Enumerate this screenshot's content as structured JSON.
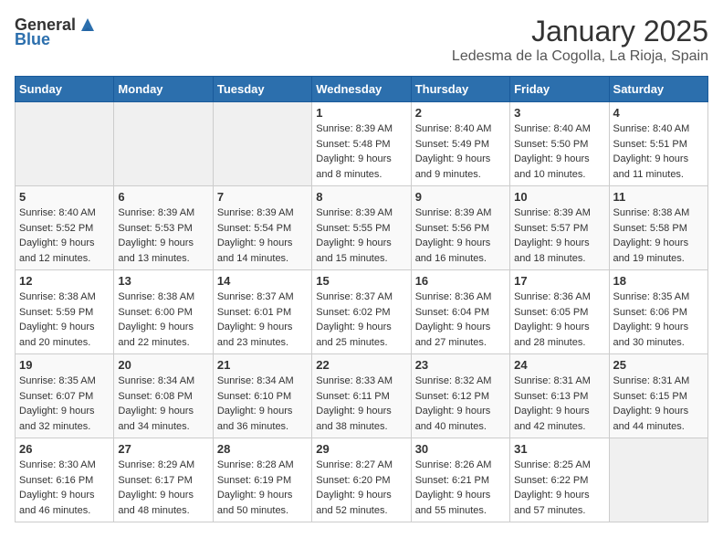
{
  "header": {
    "logo": {
      "general": "General",
      "blue": "Blue"
    },
    "title": "January 2025",
    "subtitle": "Ledesma de la Cogolla, La Rioja, Spain"
  },
  "calendar": {
    "days_of_week": [
      "Sunday",
      "Monday",
      "Tuesday",
      "Wednesday",
      "Thursday",
      "Friday",
      "Saturday"
    ],
    "weeks": [
      [
        {
          "day": "",
          "info": ""
        },
        {
          "day": "",
          "info": ""
        },
        {
          "day": "",
          "info": ""
        },
        {
          "day": "1",
          "info": "Sunrise: 8:39 AM\nSunset: 5:48 PM\nDaylight: 9 hours and 8 minutes."
        },
        {
          "day": "2",
          "info": "Sunrise: 8:40 AM\nSunset: 5:49 PM\nDaylight: 9 hours and 9 minutes."
        },
        {
          "day": "3",
          "info": "Sunrise: 8:40 AM\nSunset: 5:50 PM\nDaylight: 9 hours and 10 minutes."
        },
        {
          "day": "4",
          "info": "Sunrise: 8:40 AM\nSunset: 5:51 PM\nDaylight: 9 hours and 11 minutes."
        }
      ],
      [
        {
          "day": "5",
          "info": "Sunrise: 8:40 AM\nSunset: 5:52 PM\nDaylight: 9 hours and 12 minutes."
        },
        {
          "day": "6",
          "info": "Sunrise: 8:39 AM\nSunset: 5:53 PM\nDaylight: 9 hours and 13 minutes."
        },
        {
          "day": "7",
          "info": "Sunrise: 8:39 AM\nSunset: 5:54 PM\nDaylight: 9 hours and 14 minutes."
        },
        {
          "day": "8",
          "info": "Sunrise: 8:39 AM\nSunset: 5:55 PM\nDaylight: 9 hours and 15 minutes."
        },
        {
          "day": "9",
          "info": "Sunrise: 8:39 AM\nSunset: 5:56 PM\nDaylight: 9 hours and 16 minutes."
        },
        {
          "day": "10",
          "info": "Sunrise: 8:39 AM\nSunset: 5:57 PM\nDaylight: 9 hours and 18 minutes."
        },
        {
          "day": "11",
          "info": "Sunrise: 8:38 AM\nSunset: 5:58 PM\nDaylight: 9 hours and 19 minutes."
        }
      ],
      [
        {
          "day": "12",
          "info": "Sunrise: 8:38 AM\nSunset: 5:59 PM\nDaylight: 9 hours and 20 minutes."
        },
        {
          "day": "13",
          "info": "Sunrise: 8:38 AM\nSunset: 6:00 PM\nDaylight: 9 hours and 22 minutes."
        },
        {
          "day": "14",
          "info": "Sunrise: 8:37 AM\nSunset: 6:01 PM\nDaylight: 9 hours and 23 minutes."
        },
        {
          "day": "15",
          "info": "Sunrise: 8:37 AM\nSunset: 6:02 PM\nDaylight: 9 hours and 25 minutes."
        },
        {
          "day": "16",
          "info": "Sunrise: 8:36 AM\nSunset: 6:04 PM\nDaylight: 9 hours and 27 minutes."
        },
        {
          "day": "17",
          "info": "Sunrise: 8:36 AM\nSunset: 6:05 PM\nDaylight: 9 hours and 28 minutes."
        },
        {
          "day": "18",
          "info": "Sunrise: 8:35 AM\nSunset: 6:06 PM\nDaylight: 9 hours and 30 minutes."
        }
      ],
      [
        {
          "day": "19",
          "info": "Sunrise: 8:35 AM\nSunset: 6:07 PM\nDaylight: 9 hours and 32 minutes."
        },
        {
          "day": "20",
          "info": "Sunrise: 8:34 AM\nSunset: 6:08 PM\nDaylight: 9 hours and 34 minutes."
        },
        {
          "day": "21",
          "info": "Sunrise: 8:34 AM\nSunset: 6:10 PM\nDaylight: 9 hours and 36 minutes."
        },
        {
          "day": "22",
          "info": "Sunrise: 8:33 AM\nSunset: 6:11 PM\nDaylight: 9 hours and 38 minutes."
        },
        {
          "day": "23",
          "info": "Sunrise: 8:32 AM\nSunset: 6:12 PM\nDaylight: 9 hours and 40 minutes."
        },
        {
          "day": "24",
          "info": "Sunrise: 8:31 AM\nSunset: 6:13 PM\nDaylight: 9 hours and 42 minutes."
        },
        {
          "day": "25",
          "info": "Sunrise: 8:31 AM\nSunset: 6:15 PM\nDaylight: 9 hours and 44 minutes."
        }
      ],
      [
        {
          "day": "26",
          "info": "Sunrise: 8:30 AM\nSunset: 6:16 PM\nDaylight: 9 hours and 46 minutes."
        },
        {
          "day": "27",
          "info": "Sunrise: 8:29 AM\nSunset: 6:17 PM\nDaylight: 9 hours and 48 minutes."
        },
        {
          "day": "28",
          "info": "Sunrise: 8:28 AM\nSunset: 6:19 PM\nDaylight: 9 hours and 50 minutes."
        },
        {
          "day": "29",
          "info": "Sunrise: 8:27 AM\nSunset: 6:20 PM\nDaylight: 9 hours and 52 minutes."
        },
        {
          "day": "30",
          "info": "Sunrise: 8:26 AM\nSunset: 6:21 PM\nDaylight: 9 hours and 55 minutes."
        },
        {
          "day": "31",
          "info": "Sunrise: 8:25 AM\nSunset: 6:22 PM\nDaylight: 9 hours and 57 minutes."
        },
        {
          "day": "",
          "info": ""
        }
      ]
    ]
  }
}
